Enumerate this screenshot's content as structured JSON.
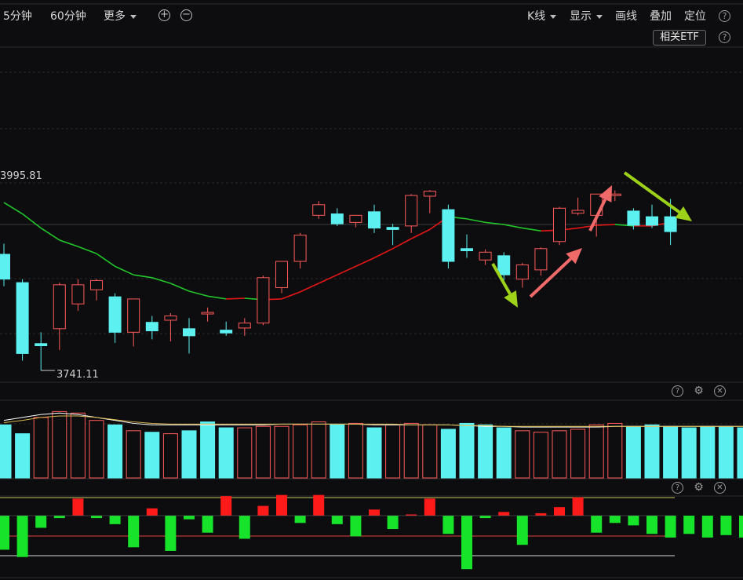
{
  "toolbar": {
    "period_5m": "5分钟",
    "period_60m": "60分钟",
    "more": "更多",
    "zoom_in_glyph": "+",
    "zoom_out_glyph": "−",
    "kline": "K线",
    "display": "显示",
    "draw": "画线",
    "overlay": "叠加",
    "locate": "定位",
    "help_glyph": "?"
  },
  "etf_button": "相关ETF",
  "price_labels": {
    "high": "3995.81",
    "low": "3741.11"
  },
  "panel_icons": {
    "help": "?",
    "settings": "⚙",
    "close": "✕"
  },
  "colors": {
    "background": "#0d0d0f",
    "up": "#ff5a5a",
    "down": "#5cf0f0",
    "ma_up": "#e51616",
    "ma_down": "#22c52a",
    "macd_pos": "#ff1a1a",
    "macd_neg": "#17e32a",
    "arrow_green": "#9ed21a",
    "arrow_red": "#f06a6a"
  },
  "chart_data": {
    "type": "candlestick",
    "candles": [
      {
        "o": 3905,
        "h": 3920,
        "l": 3860,
        "c": 3870
      },
      {
        "o": 3865,
        "h": 3870,
        "l": 3755,
        "c": 3765
      },
      {
        "o": 3779,
        "h": 3795,
        "l": 3741.11,
        "c": 3776
      },
      {
        "o": 3800,
        "h": 3865,
        "l": 3770,
        "c": 3862
      },
      {
        "o": 3835,
        "h": 3870,
        "l": 3825,
        "c": 3862
      },
      {
        "o": 3855,
        "h": 3870,
        "l": 3840,
        "c": 3868
      },
      {
        "o": 3845,
        "h": 3850,
        "l": 3780,
        "c": 3795
      },
      {
        "o": 3795,
        "h": 3842,
        "l": 3775,
        "c": 3842
      },
      {
        "o": 3809,
        "h": 3818,
        "l": 3785,
        "c": 3797
      },
      {
        "o": 3812,
        "h": 3822,
        "l": 3782,
        "c": 3818
      },
      {
        "o": 3800,
        "h": 3815,
        "l": 3765,
        "c": 3790
      },
      {
        "o": 3821,
        "h": 3830,
        "l": 3810,
        "c": 3823
      },
      {
        "o": 3798,
        "h": 3810,
        "l": 3790,
        "c": 3794
      },
      {
        "o": 3801,
        "h": 3815,
        "l": 3790,
        "c": 3808
      },
      {
        "o": 3808,
        "h": 3875,
        "l": 3805,
        "c": 3872
      },
      {
        "o": 3858,
        "h": 3895,
        "l": 3850,
        "c": 3895
      },
      {
        "o": 3895,
        "h": 3935,
        "l": 3885,
        "c": 3932
      },
      {
        "o": 3960,
        "h": 3980,
        "l": 3955,
        "c": 3975
      },
      {
        "o": 3962,
        "h": 3970,
        "l": 3945,
        "c": 3948
      },
      {
        "o": 3950,
        "h": 3960,
        "l": 3943,
        "c": 3960
      },
      {
        "o": 3965,
        "h": 3975,
        "l": 3935,
        "c": 3942
      },
      {
        "o": 3943,
        "h": 3948,
        "l": 3918,
        "c": 3940
      },
      {
        "o": 3945,
        "h": 3990,
        "l": 3935,
        "c": 3988
      },
      {
        "o": 3987,
        "h": 3995.81,
        "l": 3963,
        "c": 3994
      },
      {
        "o": 3968,
        "h": 3975,
        "l": 3885,
        "c": 3895
      },
      {
        "o": 3913,
        "h": 3933,
        "l": 3900,
        "c": 3910
      },
      {
        "o": 3897,
        "h": 3912,
        "l": 3890,
        "c": 3908
      },
      {
        "o": 3903,
        "h": 3908,
        "l": 3860,
        "c": 3876
      },
      {
        "o": 3870,
        "h": 3893,
        "l": 3858,
        "c": 3890
      },
      {
        "o": 3883,
        "h": 3915,
        "l": 3875,
        "c": 3913
      },
      {
        "o": 3923,
        "h": 3972,
        "l": 3918,
        "c": 3970
      },
      {
        "o": 3963,
        "h": 3985,
        "l": 3960,
        "c": 3967
      },
      {
        "o": 3960,
        "h": 3990,
        "l": 3930,
        "c": 3990
      },
      {
        "o": 3988,
        "h": 3995,
        "l": 3980,
        "c": 3990
      },
      {
        "o": 3966,
        "h": 3970,
        "l": 3940,
        "c": 3946
      },
      {
        "o": 3958,
        "h": 3975,
        "l": 3942,
        "c": 3946
      },
      {
        "o": 3958,
        "h": 3983,
        "l": 3918,
        "c": 3937
      }
    ],
    "ma": [
      3978,
      3962,
      3942,
      3925,
      3916,
      3906,
      3888,
      3876,
      3872,
      3864,
      3853,
      3846,
      3842,
      3843,
      3841,
      3842,
      3852,
      3864,
      3876,
      3888,
      3900,
      3913,
      3927,
      3940,
      3958,
      3955,
      3950,
      3947,
      3942,
      3938,
      3939,
      3942,
      3946,
      3947,
      3945,
      3945,
      3950
    ],
    "volume": [
      72,
      60,
      82,
      90,
      88,
      78,
      72,
      64,
      62,
      60,
      64,
      76,
      68,
      68,
      70,
      70,
      72,
      76,
      72,
      74,
      68,
      72,
      74,
      72,
      66,
      74,
      72,
      68,
      64,
      62,
      64,
      66,
      72,
      74,
      70,
      72,
      70,
      68,
      70,
      70,
      68,
      70
    ],
    "volume_dir": [
      -1,
      -1,
      1,
      1,
      1,
      1,
      -1,
      1,
      -1,
      1,
      -1,
      -1,
      -1,
      1,
      1,
      1,
      1,
      1,
      -1,
      1,
      -1,
      1,
      1,
      1,
      -1,
      -1,
      -1,
      -1,
      1,
      1,
      1,
      1,
      1,
      1,
      -1,
      -1,
      -1,
      -1,
      -1,
      -1,
      -1,
      -1
    ],
    "macd": [
      -28,
      -34,
      -10,
      -2,
      14,
      -2,
      -7,
      -26,
      6,
      -29,
      -3,
      -14,
      16,
      -19,
      8,
      17,
      -6,
      17,
      -7,
      -17,
      5,
      -11,
      1,
      14,
      -15,
      -44,
      -2,
      3,
      -24,
      2,
      7,
      15,
      -14,
      -6,
      -8,
      -15,
      -18,
      -15,
      -18,
      -16,
      -18,
      -16,
      -16
    ]
  }
}
